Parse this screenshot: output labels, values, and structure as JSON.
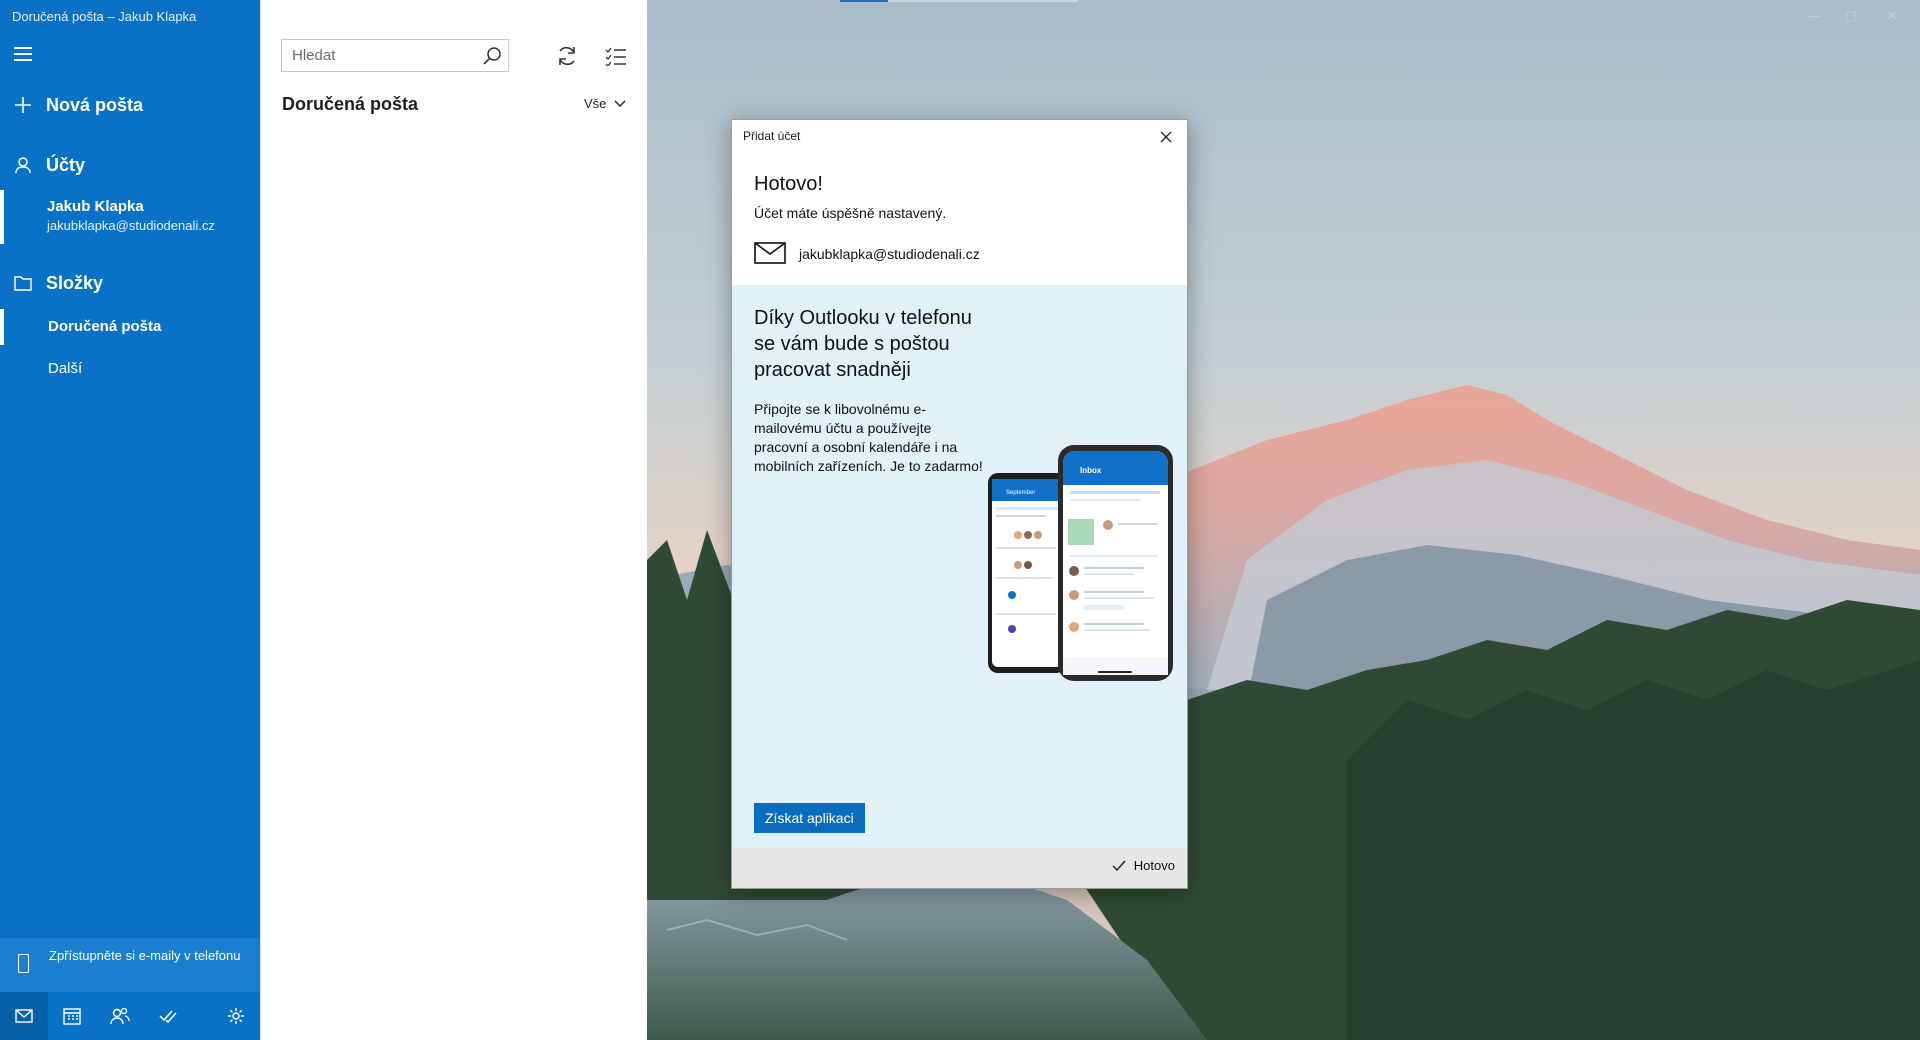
{
  "window": {
    "title": "Doručená pošta – Jakub Klapka"
  },
  "nav": {
    "new_mail": "Nová pošta",
    "accounts_label": "Účty",
    "account": {
      "name": "Jakub Klapka",
      "email": "jakubklapka@studiodenali.cz"
    },
    "folders_label": "Složky",
    "folder_items": [
      "Doručená pošta",
      "Další"
    ],
    "promo": "Zpřístupněte si e-maily v telefonu",
    "bottom_icons": [
      "mail-icon",
      "calendar-icon",
      "people-icon",
      "todo-icon",
      "settings-icon"
    ]
  },
  "list": {
    "search_placeholder": "Hledat",
    "heading": "Doručená pošta",
    "filter": "Vše"
  },
  "dialog": {
    "title": "Přidat účet",
    "heading": "Hotovo!",
    "subtitle": "Účet máte úspěšně nastavený.",
    "email": "jakubklapka@studiodenali.cz",
    "promo_heading": "Díky Outlooku v telefonu se vám bude s poštou pracovat snadněji",
    "promo_body": "Připojte se k libovolnému e-mailovému účtu a používejte pracovní a osobní kalendáře i na mobilních zařízeních. Je to zadarmo!",
    "get_app": "Získat aplikaci",
    "done": "Hotovo",
    "phone_screen_left": "September",
    "phone_screen_right": "Inbox"
  },
  "colors": {
    "nav_bg": "#0a72c6",
    "accent": "#0a6cbd",
    "promo_bg": "#e1f1f8"
  }
}
